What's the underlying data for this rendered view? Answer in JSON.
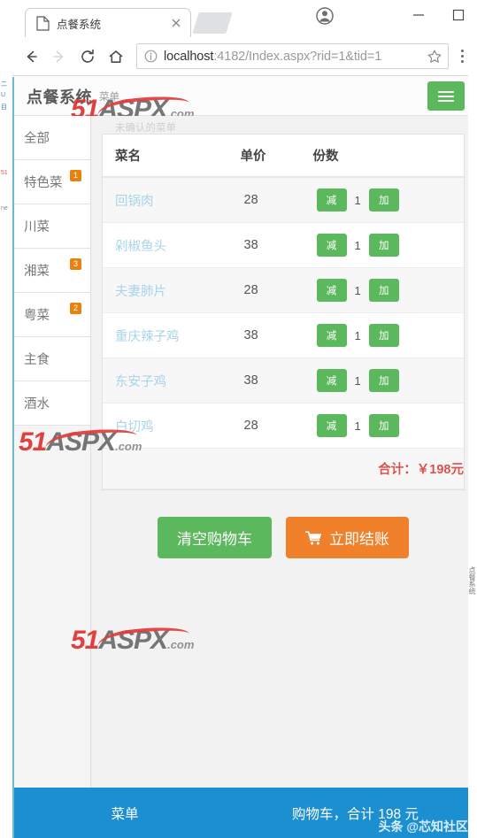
{
  "browser": {
    "tab_title": "点餐系统",
    "url_host": "localhost",
    "url_rest": ":4182/Index.aspx?rid=1&tid=1",
    "icons": {
      "favicon": "page-icon",
      "tab_close": "close-icon",
      "back": "back-arrow-icon",
      "forward": "forward-arrow-icon",
      "reload": "reload-icon",
      "home": "home-icon",
      "info": "info-circle-icon",
      "star": "star-icon",
      "menu": "three-dots-icon",
      "profile": "profile-avatar-icon",
      "minimize": "minimize-icon",
      "maximize": "maximize-icon",
      "close": "window-close-icon"
    }
  },
  "app": {
    "brand": "点餐系统",
    "brand_sub": "菜单",
    "menu_button": "hamburger-icon"
  },
  "sidebar": {
    "items": [
      {
        "label": "全部",
        "badge": ""
      },
      {
        "label": "特色菜",
        "badge": "1"
      },
      {
        "label": "川菜",
        "badge": ""
      },
      {
        "label": "湘菜",
        "badge": "3"
      },
      {
        "label": "粤菜",
        "badge": "2"
      },
      {
        "label": "主食",
        "badge": ""
      },
      {
        "label": "酒水",
        "badge": ""
      }
    ]
  },
  "main": {
    "caption": "未确认的菜单",
    "columns": [
      "菜名",
      "单价",
      "份数"
    ],
    "rows": [
      {
        "name": "回锅肉",
        "price": "28",
        "qty": "1",
        "minus": "减",
        "plus": "加"
      },
      {
        "name": "剁椒鱼头",
        "price": "38",
        "qty": "1",
        "minus": "减",
        "plus": "加"
      },
      {
        "name": "夫妻肺片",
        "price": "28",
        "qty": "1",
        "minus": "减",
        "plus": "加"
      },
      {
        "name": "重庆辣子鸡",
        "price": "38",
        "qty": "1",
        "minus": "减",
        "plus": "加"
      },
      {
        "name": "东安子鸡",
        "price": "38",
        "qty": "1",
        "minus": "减",
        "plus": "加"
      },
      {
        "name": "白切鸡",
        "price": "28",
        "qty": "1",
        "minus": "减",
        "plus": "加"
      }
    ],
    "total_text": "合计：￥198元",
    "clear_cart_label": "清空购物车",
    "checkout_label": "立即结账",
    "checkout_icon": "shopping-cart-icon"
  },
  "bottombar": {
    "left_label": "菜单",
    "right_label": "购物车，合计 198 元",
    "watermark": "头条 @芯知社区"
  },
  "watermark": {
    "part1": "51",
    "part2": "ASPX",
    "part3": ".com"
  },
  "colors": {
    "green": "#5cb85c",
    "orange": "#f0802a",
    "badge_orange": "#e8820c",
    "blue_bar": "#1c8fd0",
    "total_red": "#d9534f",
    "link_blue": "#a8d4e8"
  },
  "left_strip_fragments": [
    "二",
    "U",
    "目",
    "51",
    "ne"
  ],
  "right_strip_fragment": "点餐系统"
}
